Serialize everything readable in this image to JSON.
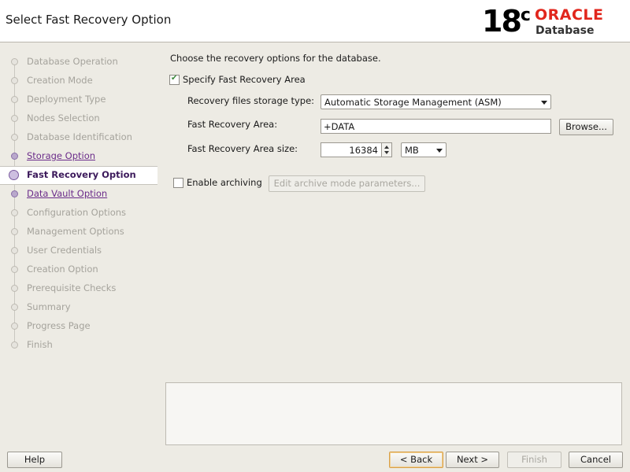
{
  "window": {
    "title": "Select Fast Recovery Option",
    "logo": {
      "version": "18",
      "version_suffix": "c",
      "brand": "ORACLE",
      "product": "Database",
      "brand_color": "#e1261c"
    }
  },
  "sidebar": {
    "steps": [
      {
        "label": "Database Operation",
        "state": "pending"
      },
      {
        "label": "Creation Mode",
        "state": "pending"
      },
      {
        "label": "Deployment Type",
        "state": "pending"
      },
      {
        "label": "Nodes Selection",
        "state": "pending"
      },
      {
        "label": "Database Identification",
        "state": "pending"
      },
      {
        "label": "Storage Option",
        "state": "visited"
      },
      {
        "label": "Fast Recovery Option",
        "state": "current"
      },
      {
        "label": "Data Vault Option",
        "state": "visited"
      },
      {
        "label": "Configuration Options",
        "state": "pending"
      },
      {
        "label": "Management Options",
        "state": "pending"
      },
      {
        "label": "User Credentials",
        "state": "pending"
      },
      {
        "label": "Creation Option",
        "state": "pending"
      },
      {
        "label": "Prerequisite Checks",
        "state": "pending"
      },
      {
        "label": "Summary",
        "state": "pending"
      },
      {
        "label": "Progress Page",
        "state": "pending"
      },
      {
        "label": "Finish",
        "state": "pending"
      }
    ]
  },
  "main": {
    "intro": "Choose the recovery options for the database.",
    "specify_fra": {
      "label": "Specify Fast Recovery Area",
      "checked": true
    },
    "storage_type": {
      "label": "Recovery files storage type:",
      "value": "Automatic Storage Management (ASM)"
    },
    "fra_location": {
      "label": "Fast Recovery Area:",
      "value": "+DATA",
      "browse_label": "Browse..."
    },
    "fra_size": {
      "label": "Fast Recovery Area size:",
      "value": "16384",
      "unit": "MB"
    },
    "archiving": {
      "label": "Enable archiving",
      "checked": false,
      "edit_label": "Edit archive mode parameters..."
    }
  },
  "footer": {
    "help": "Help",
    "back": "< Back",
    "next": "Next >",
    "finish": "Finish",
    "cancel": "Cancel"
  }
}
